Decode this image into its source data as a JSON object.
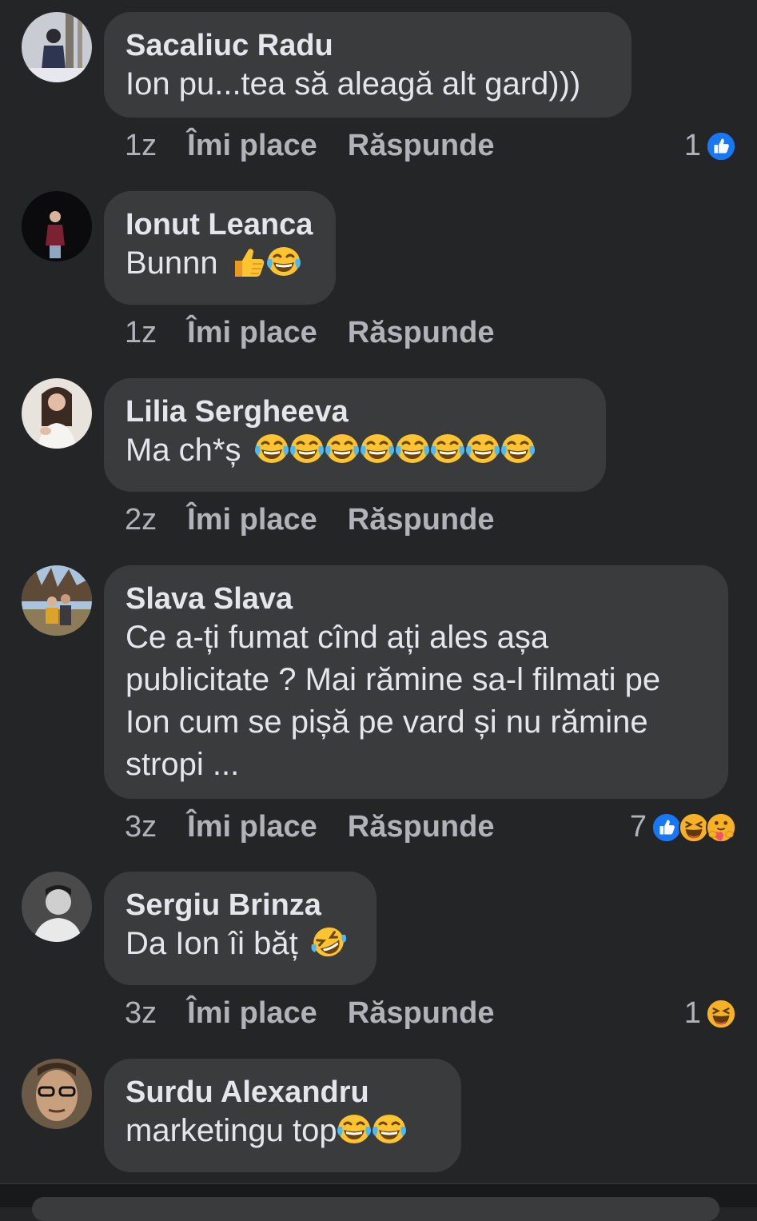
{
  "labels": {
    "like": "Îmi place",
    "reply": "Răspunde"
  },
  "colors": {
    "background": "#242526",
    "bubble": "#3a3b3c",
    "like_blue": "#1877f2",
    "muted": "#b0b3b8"
  },
  "comments": [
    {
      "author": "Sacaliuc Radu",
      "text": "Ion pu...tea să aleagă alt gard)))",
      "emojis": [],
      "time": "1z",
      "reaction_count": "1",
      "reactions": [
        "like-icon"
      ]
    },
    {
      "author": "Ionut Leanca",
      "text": "Bunnn ",
      "emojis": [
        "thumbs-up-emoji",
        "tears-of-joy-emoji"
      ],
      "time": "1z",
      "reaction_count": "",
      "reactions": []
    },
    {
      "author": "Lilia Sergheeva",
      "text": "Ma ch*ș ",
      "emojis": [
        "tears-of-joy-emoji",
        "tears-of-joy-emoji",
        "tears-of-joy-emoji",
        "tears-of-joy-emoji",
        "tears-of-joy-emoji",
        "tears-of-joy-emoji",
        "tears-of-joy-emoji",
        "tears-of-joy-emoji"
      ],
      "time": "2z",
      "reaction_count": "",
      "reactions": []
    },
    {
      "author": "Slava Slava",
      "text": "Ce a-ți fumat cînd ați ales așa\npublicitate ? Mai rămine sa-l filmati pe\nIon cum se pișă pe vard și nu rămine\nstropi ...",
      "emojis": [],
      "time": "3z",
      "reaction_count": "7",
      "reactions": [
        "like-icon",
        "haha-icon",
        "care-icon"
      ]
    },
    {
      "author": "Sergiu Brinza",
      "text": "Da Ion îi băț ",
      "emojis": [
        "rofl-emoji"
      ],
      "time": "3z",
      "reaction_count": "1",
      "reactions": [
        "haha-icon"
      ]
    },
    {
      "author": "Surdu Alexandru",
      "text": "marketingu top",
      "emojis": [
        "tears-of-joy-emoji",
        "tears-of-joy-emoji"
      ],
      "time": "",
      "reaction_count": "",
      "reactions": []
    }
  ]
}
